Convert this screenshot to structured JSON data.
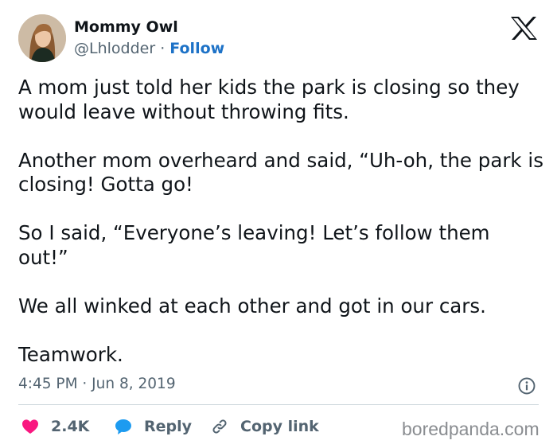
{
  "author": {
    "display_name": "Mommy Owl",
    "handle": "@Lhlodder",
    "separator": "·",
    "follow_label": "Follow"
  },
  "brand_icon": "x-logo-icon",
  "tweet": {
    "paragraphs": [
      "A mom just told her kids the park is closing so they would leave without throwing fits.",
      "Another mom overheard and said, “Uh-oh, the park is closing! Gotta go!",
      "So I said, “Everyone’s leaving! Let’s follow them out!”",
      "We all winked at each other and got in our cars.",
      "Teamwork."
    ],
    "timestamp": "4:45 PM · Jun 8, 2019"
  },
  "actions": {
    "like_count": "2.4K",
    "reply_label": "Reply",
    "copy_label": "Copy link"
  },
  "watermark": "boredpanda.com",
  "colors": {
    "text": "#0f1419",
    "muted": "#536471",
    "link": "#1d72c7",
    "like": "#f91880",
    "reply": "#1d9bf0",
    "divider": "#cfd9de"
  }
}
